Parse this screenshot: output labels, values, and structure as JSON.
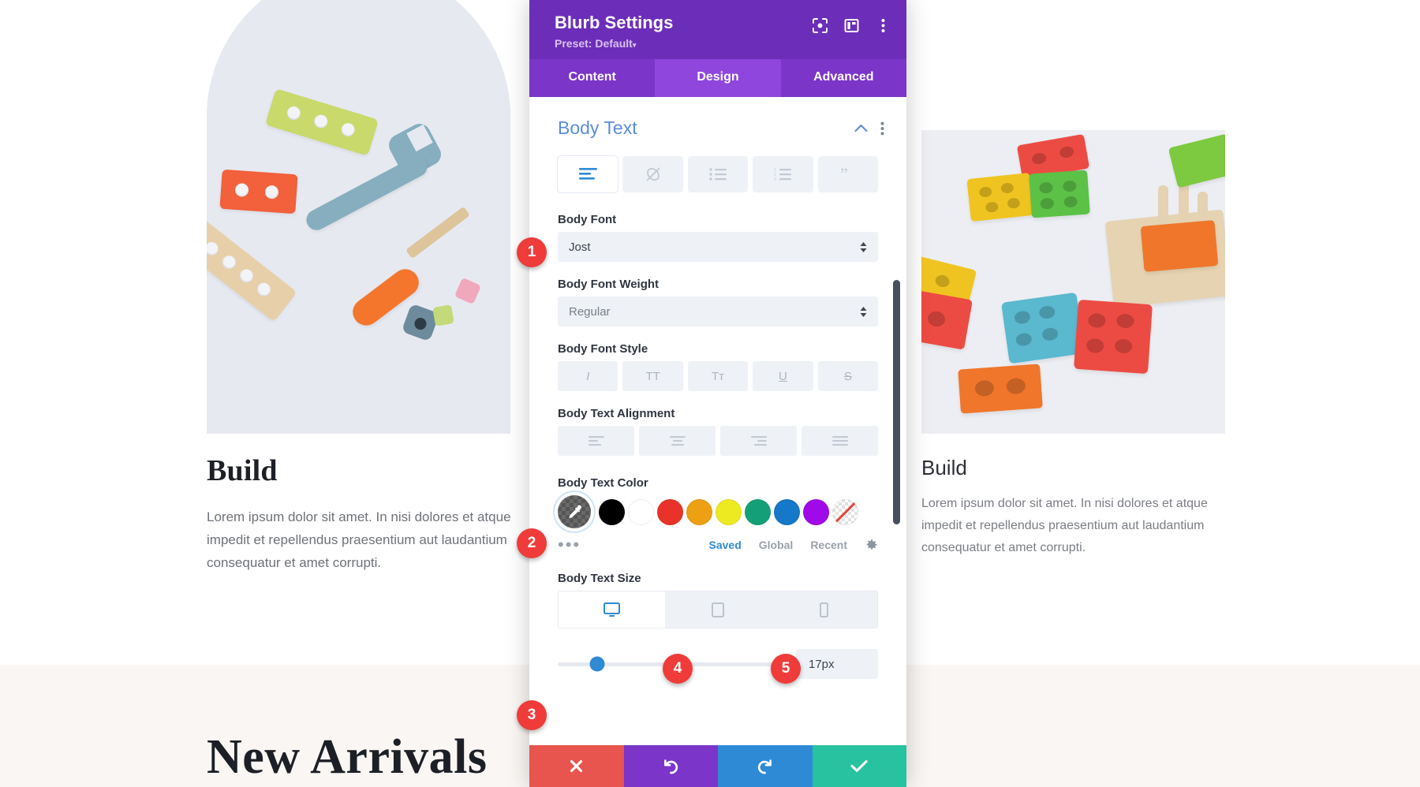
{
  "background_page": {
    "left_card": {
      "heading": "Build",
      "body": "Lorem ipsum dolor sit amet. In nisi dolores et atque impedit et repellendus praesentium aut laudantium consequatur et amet corrupti.",
      "image_alt": "wooden toy tools on arch background"
    },
    "right_card": {
      "heading": "Build",
      "body": "Lorem ipsum dolor sit amet. In nisi dolores et atque impedit et repellendus praesentium aut laudantium consequatur et amet corrupti.",
      "image_alt": "colorful wooden shape sorter blocks"
    },
    "section_heading": "New Arrivals"
  },
  "modal": {
    "title": "Blurb Settings",
    "preset_label": "Preset: Default",
    "preset_caret": "▾",
    "header_icons": [
      {
        "name": "focus-target-icon"
      },
      {
        "name": "layout-panel-icon"
      },
      {
        "name": "kebab-menu-icon"
      }
    ],
    "tabs": [
      {
        "label": "Content",
        "active": false
      },
      {
        "label": "Design",
        "active": true
      },
      {
        "label": "Advanced",
        "active": false
      }
    ],
    "section": {
      "title": "Body Text",
      "collapse_icon": "chevron-up-icon",
      "options_icon": "kebab-menu-icon"
    },
    "text_type_toolbar": [
      {
        "name": "paragraph-icon",
        "active": true
      },
      {
        "name": "link-slash-icon",
        "active": false
      },
      {
        "name": "unordered-list-icon",
        "active": false
      },
      {
        "name": "ordered-list-icon",
        "active": false
      },
      {
        "name": "blockquote-icon",
        "active": false
      }
    ],
    "body_font": {
      "label": "Body Font",
      "value": "Jost"
    },
    "body_font_weight": {
      "label": "Body Font Weight",
      "value": "Regular"
    },
    "body_font_style": {
      "label": "Body Font Style",
      "options": [
        {
          "glyph": "I",
          "name": "italic-button"
        },
        {
          "glyph": "TT",
          "name": "uppercase-button"
        },
        {
          "glyph": "Tᴛ",
          "name": "small-caps-button"
        },
        {
          "glyph": "U",
          "name": "underline-button"
        },
        {
          "glyph": "S",
          "name": "strikethrough-button"
        }
      ]
    },
    "body_text_alignment": {
      "label": "Body Text Alignment",
      "options": [
        {
          "name": "align-left-button"
        },
        {
          "name": "align-center-button"
        },
        {
          "name": "align-right-button"
        },
        {
          "name": "align-justify-button"
        }
      ]
    },
    "body_text_color": {
      "label": "Body Text Color",
      "eyedropper": {
        "name": "eyedropper-button",
        "selected": true
      },
      "swatches": [
        {
          "name": "swatch-black",
          "hex": "#000000"
        },
        {
          "name": "swatch-white",
          "hex": "#ffffff"
        },
        {
          "name": "swatch-red",
          "hex": "#e8322a"
        },
        {
          "name": "swatch-orange",
          "hex": "#eda012"
        },
        {
          "name": "swatch-yellow",
          "hex": "#eeea22"
        },
        {
          "name": "swatch-teal",
          "hex": "#14a077"
        },
        {
          "name": "swatch-blue",
          "hex": "#1578c8"
        },
        {
          "name": "swatch-purple",
          "hex": "#a009e8"
        },
        {
          "name": "swatch-transparent",
          "hex": "transparent"
        }
      ],
      "more_dots": "•••",
      "source_tabs": [
        {
          "label": "Saved",
          "active": true
        },
        {
          "label": "Global",
          "active": false
        },
        {
          "label": "Recent",
          "active": false
        }
      ],
      "settings_icon": "gear-icon"
    },
    "body_text_size": {
      "label": "Body Text Size",
      "devices": [
        {
          "name": "desktop-view-button",
          "active": true
        },
        {
          "name": "tablet-view-button",
          "active": false
        },
        {
          "name": "phone-view-button",
          "active": false
        }
      ],
      "slider_percent": 17.5,
      "value": "17px"
    },
    "footer_buttons": [
      {
        "name": "cancel-button",
        "icon": "close-icon",
        "color": "#e8544e"
      },
      {
        "name": "undo-button",
        "icon": "undo-icon",
        "color": "#7b35c9"
      },
      {
        "name": "redo-button",
        "icon": "redo-icon",
        "color": "#2f8ad6"
      },
      {
        "name": "save-button",
        "icon": "checkmark-icon",
        "color": "#28c2a0"
      }
    ],
    "scrollbar": {
      "name": "panel-scrollbar"
    }
  },
  "annotation_badges": [
    {
      "number": "1",
      "target": "body-font-select"
    },
    {
      "number": "2",
      "target": "eyedropper-button"
    },
    {
      "number": "3",
      "target": "body-text-size-slider"
    },
    {
      "number": "4",
      "target": "tablet-view-button"
    },
    {
      "number": "5",
      "target": "phone-view-button"
    }
  ]
}
